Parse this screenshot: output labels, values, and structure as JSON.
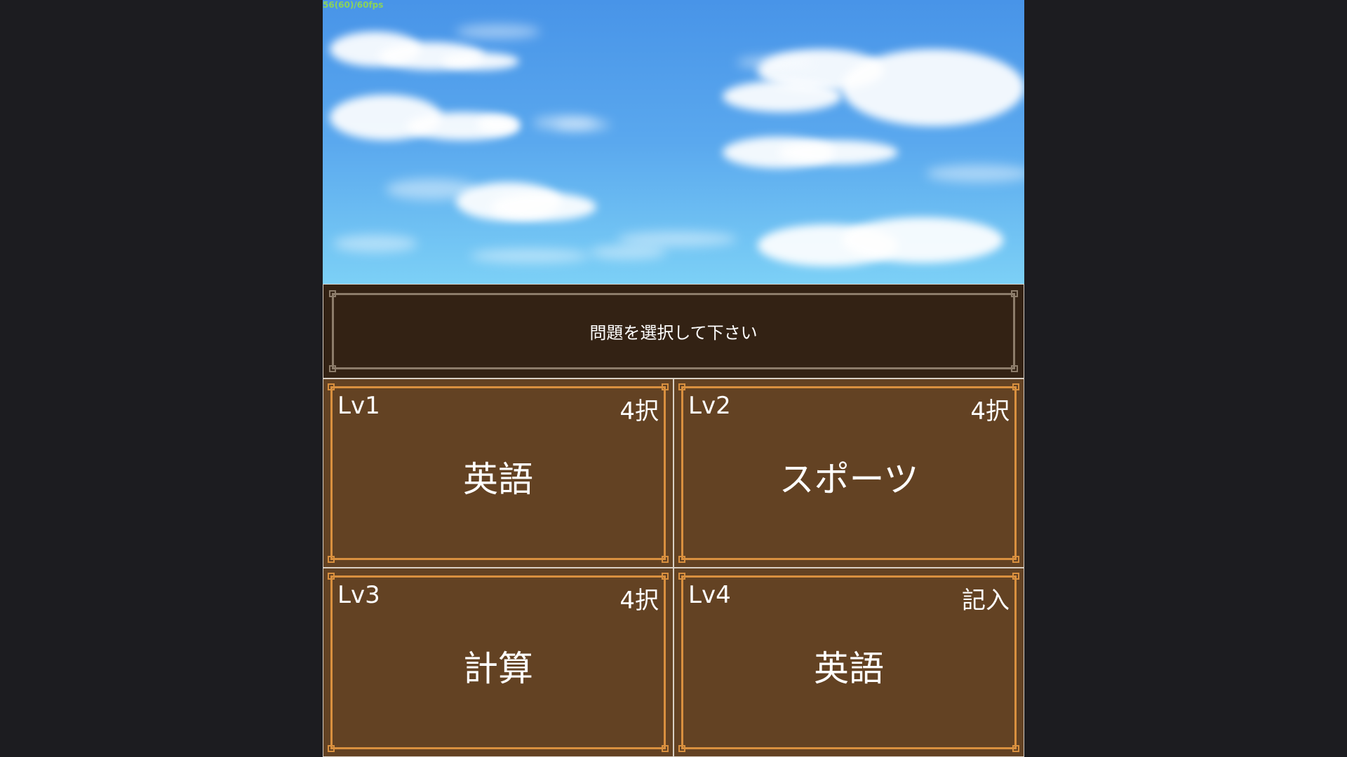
{
  "fps_counter": "56(60)/60fps",
  "prompt": "問題を選択して下さい",
  "colors": {
    "outer_background": "#1c1c20",
    "sky_top": "#4894e8",
    "sky_bottom": "#7cd0f6",
    "prompt_panel": "#332214",
    "prompt_frame": "#8c7c6a",
    "choice_panel": "#634223",
    "choice_frame": "#d9903f",
    "fps_text": "#8bd35b"
  },
  "choices": [
    {
      "level": "Lv1",
      "type": "4択",
      "genre": "英語"
    },
    {
      "level": "Lv2",
      "type": "4択",
      "genre": "スポーツ"
    },
    {
      "level": "Lv3",
      "type": "4択",
      "genre": "計算"
    },
    {
      "level": "Lv4",
      "type": "記入",
      "genre": "英語"
    }
  ]
}
